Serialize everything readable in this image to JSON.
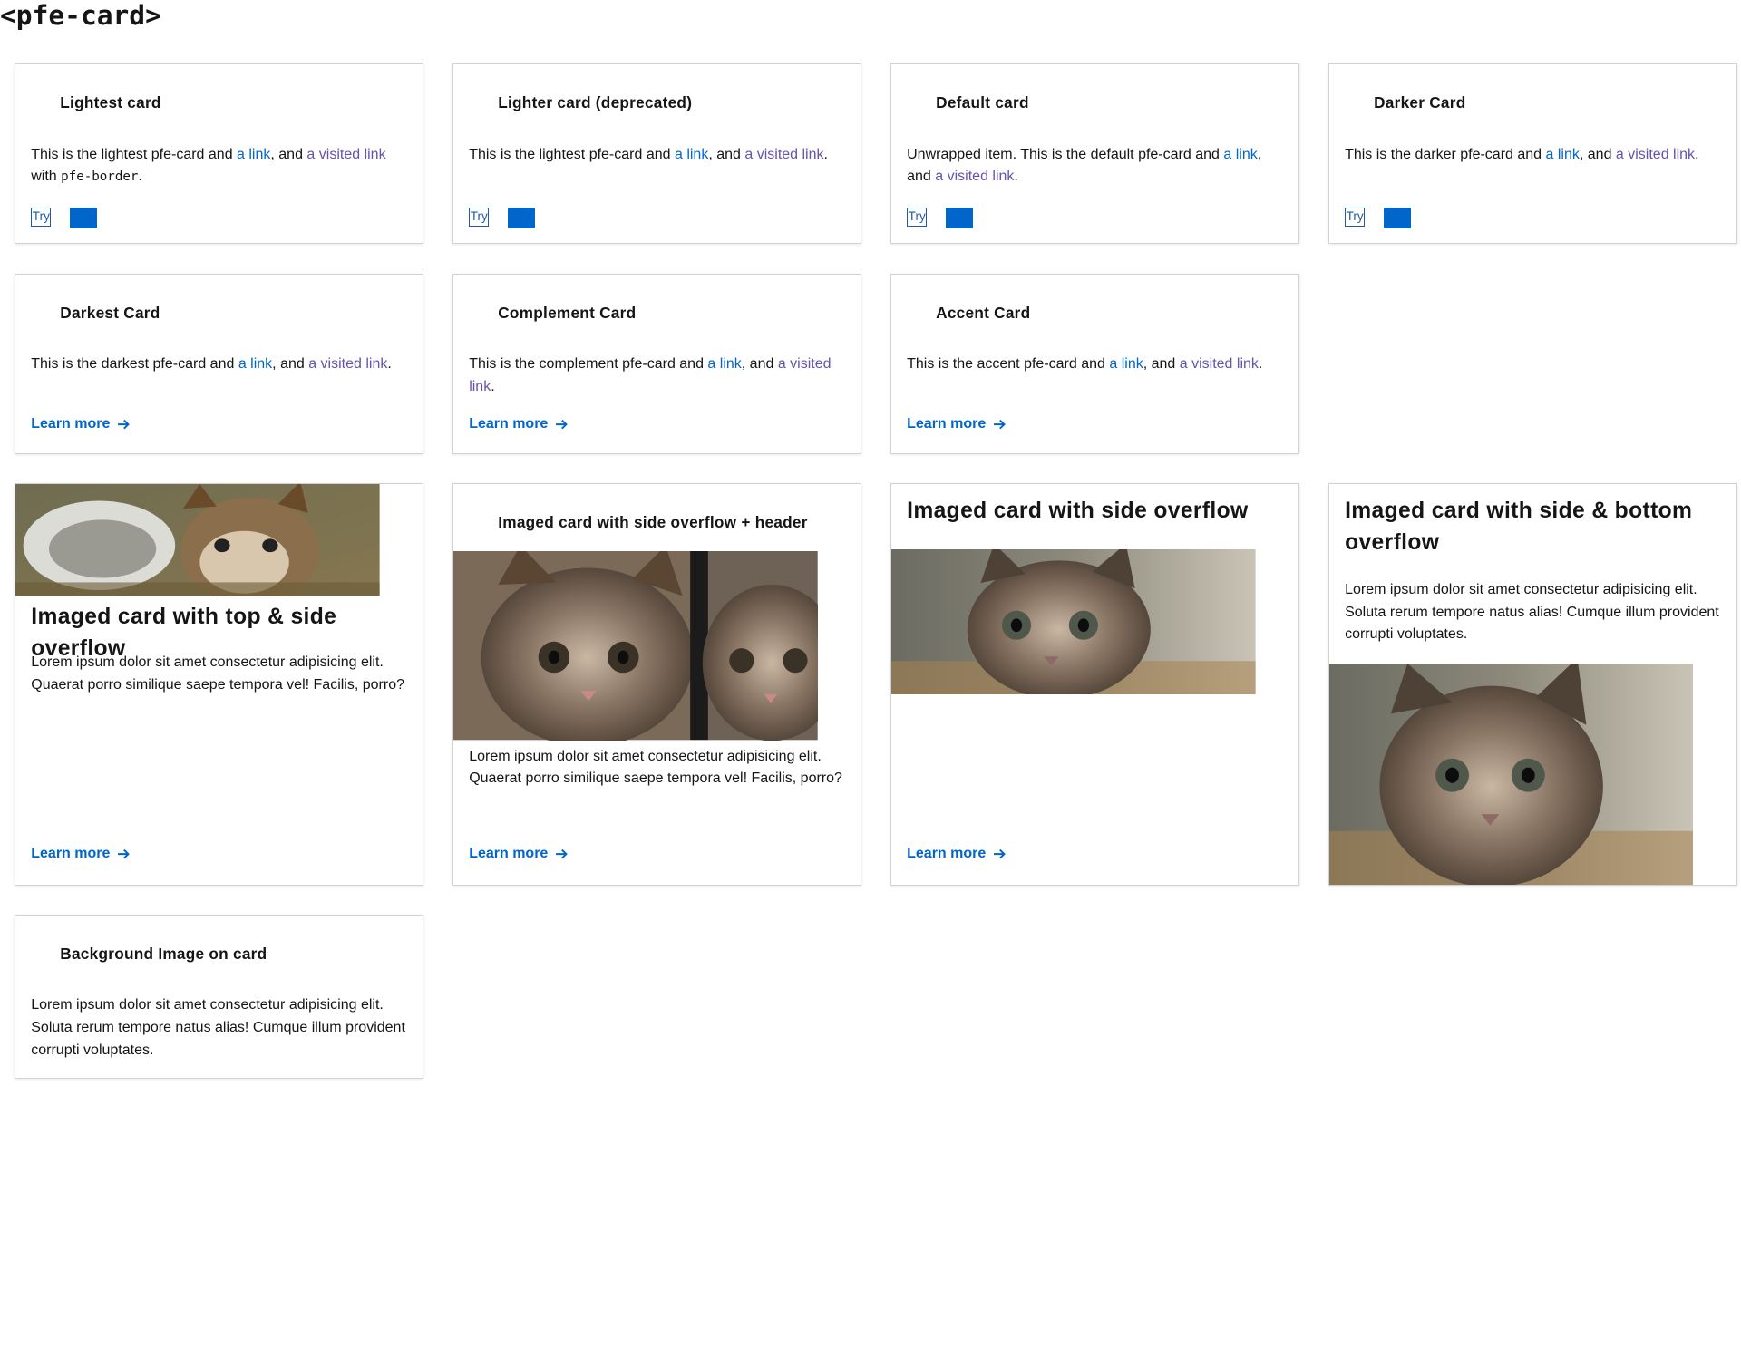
{
  "page": {
    "title": "<pfe-card>"
  },
  "common": {
    "link_text": "a link",
    "visited_text": "a visited link",
    "learn_more": "Learn more",
    "try_label": "Try"
  },
  "cards": {
    "lightest": {
      "title": "Lightest card",
      "text_before": "This is the lightest pfe-card and ",
      "mid": ", and ",
      "after_visited": " with ",
      "code": "pfe-border",
      "end": "."
    },
    "lighter": {
      "title": "Lighter card (deprecated)",
      "text_before": "This is the lightest pfe-card and ",
      "mid": ", and ",
      "end": "."
    },
    "default": {
      "title": "Default card",
      "text_before": "Unwrapped item. This is the default pfe-card and ",
      "mid": ", and ",
      "end": "."
    },
    "darker": {
      "title": "Darker Card",
      "text_before": "This is the darker pfe-card and ",
      "mid": ", and ",
      "end": "."
    },
    "darkest": {
      "title": "Darkest Card",
      "text_before": "This is the darkest pfe-card and ",
      "mid": ", and ",
      "end": "."
    },
    "complement": {
      "title": "Complement Card",
      "text_before": "This is the complement pfe-card and ",
      "mid": ", and ",
      "end": "."
    },
    "accent": {
      "title": "Accent Card",
      "text_before": "This is the accent pfe-card and ",
      "mid": ", and ",
      "end": "."
    },
    "top_side": {
      "title": "Imaged card with top & side overflow",
      "body": "Lorem ipsum dolor sit amet consectetur adipisicing elit. Quaerat porro similique saepe tempora vel! Facilis, porro?"
    },
    "side_header": {
      "title": "Imaged card with side overflow + header",
      "body": "Lorem ipsum dolor sit amet consectetur adipisicing elit. Quaerat porro similique saepe tempora vel! Facilis, porro?"
    },
    "side": {
      "title": "Imaged card with side overflow"
    },
    "side_bottom": {
      "title": "Imaged card with side & bottom overflow",
      "body": "Lorem ipsum dolor sit amet consectetur adipisicing elit. Soluta rerum tempore natus alias! Cumque illum provident corrupti voluptates."
    },
    "bg_image": {
      "title": "Background Image on card",
      "body": "Lorem ipsum dolor sit amet consectetur adipisicing elit. Soluta rerum tempore natus alias! Cumque illum provident corrupti voluptates."
    }
  },
  "colors": {
    "link": "#0066cc",
    "visited": "#6753ac",
    "accent_square": "#0066cc",
    "border": "#d2d2d2"
  },
  "icons": {
    "learn_more": "arrow-right-icon",
    "images": "kitten-photo"
  }
}
